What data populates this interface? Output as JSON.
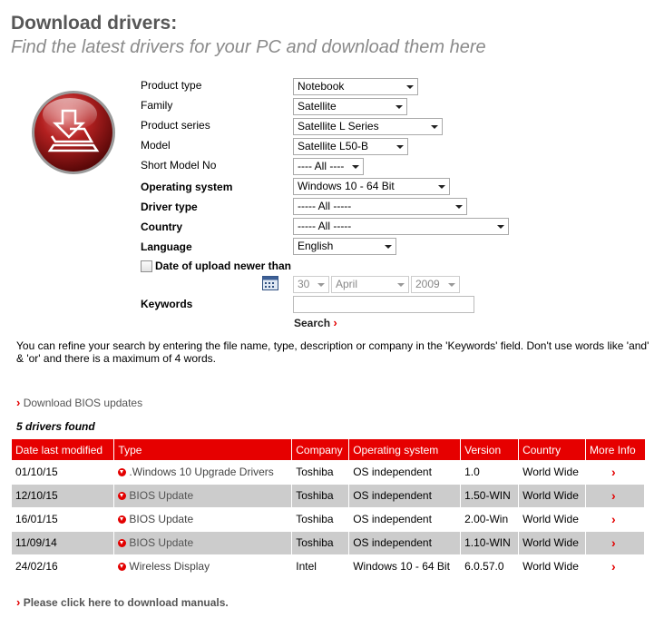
{
  "header": {
    "title": "Download drivers:",
    "subtitle": "Find the latest drivers for your PC and download them here"
  },
  "form": {
    "product_type": {
      "label": "Product type",
      "value": "Notebook"
    },
    "family": {
      "label": "Family",
      "value": "Satellite"
    },
    "product_series": {
      "label": "Product series",
      "value": "Satellite L Series"
    },
    "model": {
      "label": "Model",
      "value": "Satellite L50-B"
    },
    "short_model": {
      "label": "Short Model No",
      "value": "---- All ----"
    },
    "os": {
      "label": "Operating system",
      "value": "Windows 10 - 64 Bit"
    },
    "driver_type": {
      "label": "Driver type",
      "value": "----- All -----"
    },
    "country": {
      "label": "Country",
      "value": "----- All -----"
    },
    "language": {
      "label": "Language",
      "value": "English"
    },
    "date_upload": {
      "label": "Date of upload newer than",
      "checked": false,
      "day": "30",
      "month": "April",
      "year": "2009"
    },
    "keywords": {
      "label": "Keywords",
      "value": ""
    },
    "search_label": "Search"
  },
  "info_text": "You can refine your search by entering the file name, type, description or company in the 'Keywords' field. Don't use words like 'and' & 'or' and there is a maximum of 4 words.",
  "bios_link": "Download BIOS updates",
  "results_count": "5 drivers found",
  "table": {
    "headers": [
      "Date last modified",
      "Type",
      "Company",
      "Operating system",
      "Version",
      "Country",
      "More Info"
    ],
    "rows": [
      {
        "date": "01/10/15",
        "type": ".Windows 10 Upgrade Drivers",
        "company": "Toshiba",
        "os": "OS independent",
        "version": "1.0",
        "country": "World Wide"
      },
      {
        "date": "12/10/15",
        "type": "BIOS Update",
        "company": "Toshiba",
        "os": "OS independent",
        "version": "1.50-WIN",
        "country": "World Wide"
      },
      {
        "date": "16/01/15",
        "type": "BIOS Update",
        "company": "Toshiba",
        "os": "OS independent",
        "version": "2.00-Win",
        "country": "World Wide"
      },
      {
        "date": "11/09/14",
        "type": "BIOS Update",
        "company": "Toshiba",
        "os": "OS independent",
        "version": "1.10-WIN",
        "country": "World Wide"
      },
      {
        "date": "24/02/16",
        "type": "Wireless Display",
        "company": "Intel",
        "os": "Windows 10 - 64 Bit",
        "version": "6.0.57.0",
        "country": "World Wide"
      }
    ]
  },
  "manuals_link": "Please click here to download manuals.",
  "icons": {
    "download": "download-drivers-icon",
    "calendar": "calendar-icon",
    "chevron": "red-chevron-icon"
  },
  "colors": {
    "accent": "#e60000",
    "row_alt": "#cccccc",
    "title": "#575757",
    "subtitle": "#8a8a8a"
  }
}
